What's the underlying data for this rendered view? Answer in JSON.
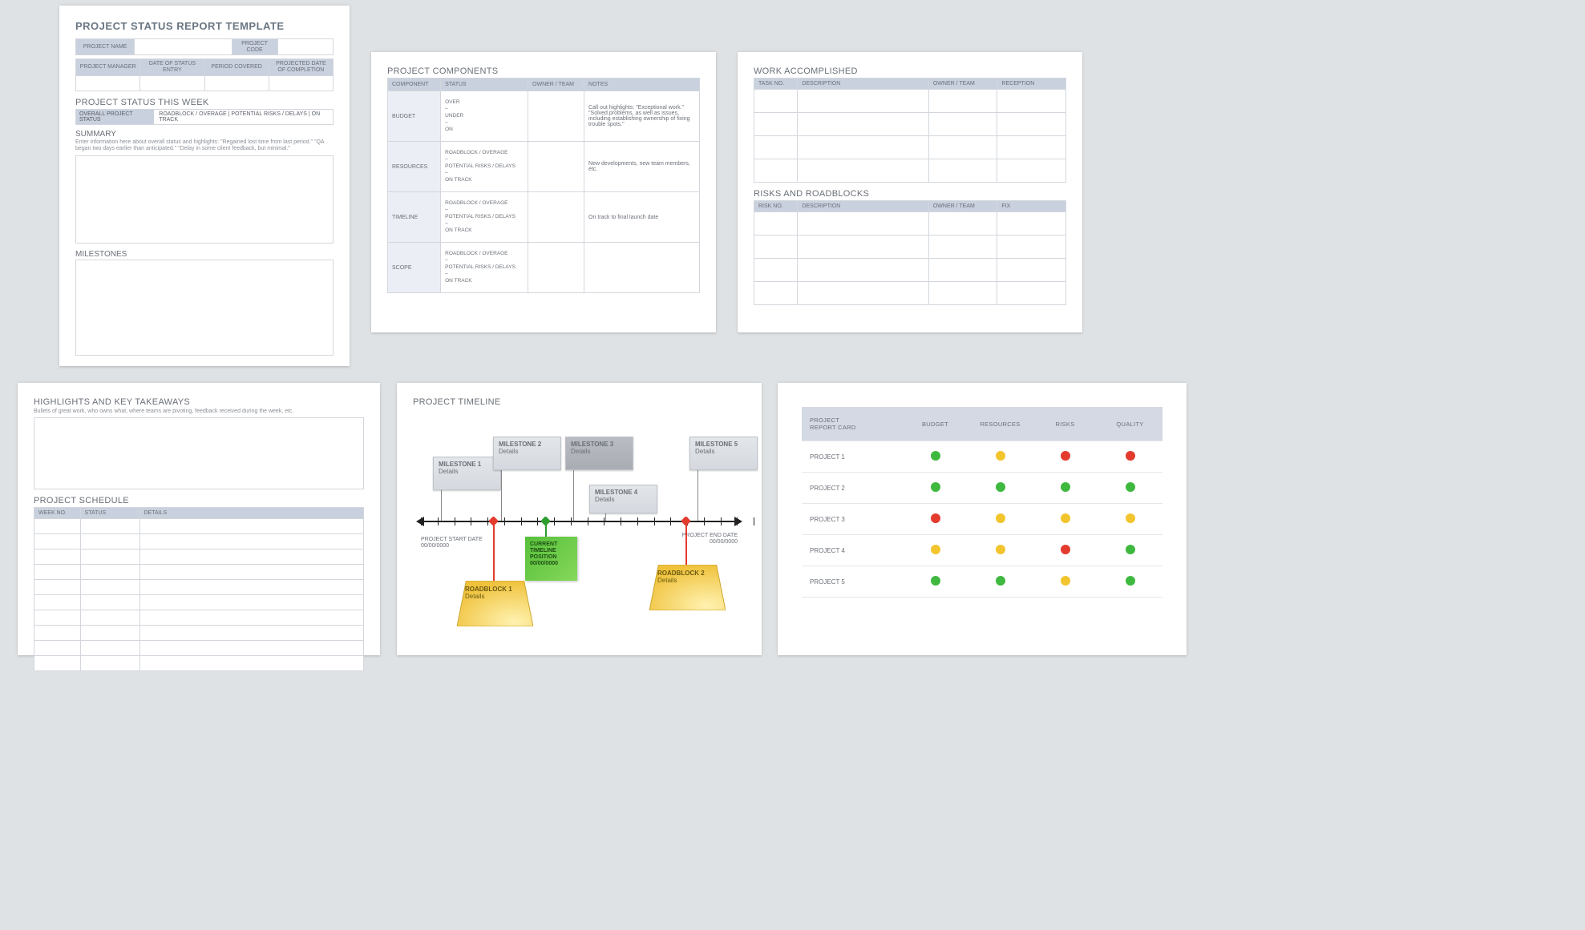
{
  "cardA": {
    "title": "PROJECT STATUS REPORT TEMPLATE",
    "row1": {
      "name": "PROJECT NAME",
      "code": "PROJECT CODE"
    },
    "row2": [
      "PROJECT MANAGER",
      "DATE OF STATUS ENTRY",
      "PERIOD COVERED",
      "PROJECTED DATE OF COMPLETION"
    ],
    "statusWeek": "PROJECT STATUS THIS WEEK",
    "statusRowLead": "OVERALL PROJECT STATUS",
    "statusOpts": "ROADBLOCK / OVERAGE   |   POTENTIAL RISKS / DELAYS   |   ON TRACK",
    "summary": "SUMMARY",
    "summaryHelp": "Enter information here about overall status and highlights: \"Regained lost time from last period.\" \"QA began two days earlier than anticipated.\" \"Delay in some client feedback, but minimal.\"",
    "milestones": "MILESTONES"
  },
  "cardB": {
    "title": "PROJECT COMPONENTS",
    "cols": [
      "COMPONENT",
      "STATUS",
      "OWNER / TEAM",
      "NOTES"
    ],
    "rows": [
      {
        "name": "BUDGET",
        "status": "OVER\n–\nUNDER\n–\nON",
        "notes": "Call out highlights: \"Exceptional work.\" \"Solved problems, as well as issues, including establishing ownership of fixing trouble spots.\""
      },
      {
        "name": "RESOURCES",
        "status": "ROADBLOCK / OVERAGE\n–\nPOTENTIAL RISKS / DELAYS\n–\nON TRACK",
        "notes": "New developments, new team members, etc."
      },
      {
        "name": "TIMELINE",
        "status": "ROADBLOCK / OVERAGE\n–\nPOTENTIAL RISKS / DELAYS\n–\nON TRACK",
        "notes": "On track to final launch date"
      },
      {
        "name": "SCOPE",
        "status": "ROADBLOCK / OVERAGE\n–\nPOTENTIAL RISKS / DELAYS\n–\nON TRACK",
        "notes": ""
      }
    ]
  },
  "cardC": {
    "work": {
      "title": "WORK ACCOMPLISHED",
      "cols": [
        "TASK NO.",
        "DESCRIPTION",
        "OWNER / TEAM",
        "RECEPTION"
      ],
      "rows": 4
    },
    "risks": {
      "title": "RISKS AND ROADBLOCKS",
      "cols": [
        "RISK NO.",
        "DESCRIPTION",
        "OWNER / TEAM",
        "FIX"
      ],
      "rows": 4
    }
  },
  "cardD": {
    "hi": "HIGHLIGHTS AND KEY TAKEAWAYS",
    "hiHelp": "Bullets of great work, who owns what, where teams are pivoting, feedback received during the week, etc.",
    "sched": "PROJECT SCHEDULE",
    "cols": [
      "WEEK NO.",
      "STATUS",
      "DETAILS"
    ],
    "rows": 10
  },
  "cardE": {
    "title": "PROJECT TIMELINE",
    "startLbl": "PROJECT START DATE",
    "startDate": "00/00/0000",
    "endLbl": "PROJECT END DATE",
    "endDate": "00/00/0000",
    "milestones": [
      {
        "n": "MILESTONE 1",
        "d": "Details"
      },
      {
        "n": "MILESTONE 2",
        "d": "Details"
      },
      {
        "n": "MILESTONE 3",
        "d": "Details"
      },
      {
        "n": "MILESTONE 4",
        "d": "Details"
      },
      {
        "n": "MILESTONE 5",
        "d": "Details"
      }
    ],
    "roadblocks": [
      {
        "n": "ROADBLOCK 1",
        "d": "Details"
      },
      {
        "n": "ROADBLOCK 2",
        "d": "Details"
      }
    ],
    "current": {
      "l1": "CURRENT",
      "l2": "TIMELINE",
      "l3": "POSITION",
      "l4": "00/00/0000"
    }
  },
  "cardF": {
    "head": [
      "PROJECT REPORT CARD",
      "BUDGET",
      "RESOURCES",
      "RISKS",
      "QUALITY"
    ],
    "rows": [
      {
        "name": "PROJECT 1",
        "s": [
          "g",
          "y",
          "r",
          "r"
        ]
      },
      {
        "name": "PROJECT 2",
        "s": [
          "g",
          "g",
          "g",
          "g"
        ]
      },
      {
        "name": "PROJECT 3",
        "s": [
          "r",
          "y",
          "y",
          "y"
        ]
      },
      {
        "name": "PROJECT 4",
        "s": [
          "y",
          "y",
          "r",
          "g"
        ]
      },
      {
        "name": "PROJECT 5",
        "s": [
          "g",
          "g",
          "y",
          "g"
        ]
      }
    ]
  }
}
